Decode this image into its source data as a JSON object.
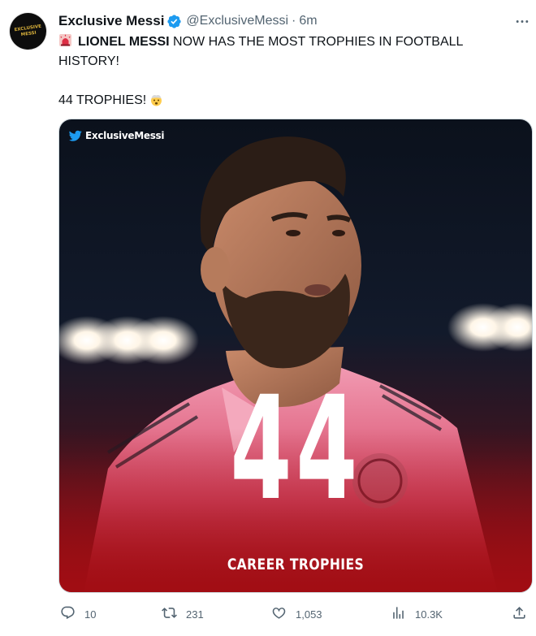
{
  "author": {
    "display_name": "Exclusive Messi",
    "handle": "@ExclusiveMessi",
    "separator": "·",
    "time": "6m",
    "avatar_text": [
      "EXCLUSIVE",
      "MESSI"
    ]
  },
  "tweet": {
    "line1_bold": "LIONEL MESSI",
    "line1_rest": " NOW HAS THE MOST TROPHIES IN FOOTBALL HISTORY!",
    "line2": "44 TROPHIES!",
    "emojis": [
      "rotating-light-emoji",
      "exploding-head-emoji"
    ]
  },
  "media": {
    "watermark": "ExclusiveMessi",
    "big_number": "44",
    "caption": "CAREER TROPHIES",
    "accent_colors": {
      "stadium_night": "#0e1420",
      "red_fade": "#a10d13",
      "jersey_pink": "#f19cb3"
    }
  },
  "actions": {
    "replies": "10",
    "retweets": "231",
    "likes": "1,053",
    "views": "10.3K"
  },
  "colors": {
    "verified": "#1d9bf0",
    "secondary_text": "#536471",
    "border": "#cfd9de"
  }
}
